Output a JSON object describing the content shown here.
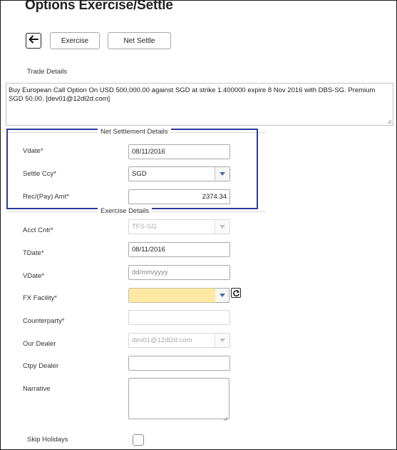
{
  "page": {
    "title": "Options Exercise/Settle"
  },
  "toolbar": {
    "back_icon": "arrow-left-icon",
    "exercise_label": "Exercise",
    "net_settle_label": "Net Settle"
  },
  "trade_details": {
    "label": "Trade Details",
    "text": "Buy European Call Option On USD 500,000.00 against SGD at strike 1.400000 expire 8 Nov 2016 with DBS-SG. Premium SGD 50.00. [dev01@12dl2d.com]"
  },
  "net_settlement": {
    "section_title": "Net Settlement Details",
    "vdate": {
      "label": "Vdate*",
      "value": "08/11/2016"
    },
    "settle_ccy": {
      "label": "Settle Ccy*",
      "value": "SGD"
    },
    "rec_pay_amt": {
      "label": "Rec/(Pay) Amt*",
      "value": "2374.34"
    },
    "highlight_color": "#2b3a9a"
  },
  "exercise": {
    "section_title": "Exercise Details",
    "acct_cntr": {
      "label": "Acct Cntr*",
      "value": "TFS-SG"
    },
    "tdate": {
      "label": "TDate*",
      "value": "08/11/2016"
    },
    "vdate": {
      "label": "VDate*",
      "value": "",
      "placeholder": "dd/mm/yyyy"
    },
    "fx_facility": {
      "label": "FX Facility*",
      "value": "",
      "refresh_icon": "refresh-icon",
      "highlight_color": "#fde9a3"
    },
    "counterparty": {
      "label": "Counterparty*",
      "value": ""
    },
    "our_dealer": {
      "label": "Our Dealer",
      "value": "dev01@12dl2d.com"
    },
    "ctpy_dealer": {
      "label": "Ctpy Dealer",
      "value": ""
    },
    "narrative": {
      "label": "Narrative",
      "value": ""
    },
    "skip_holidays": {
      "label": "Skip Holidays",
      "checked": false
    }
  }
}
